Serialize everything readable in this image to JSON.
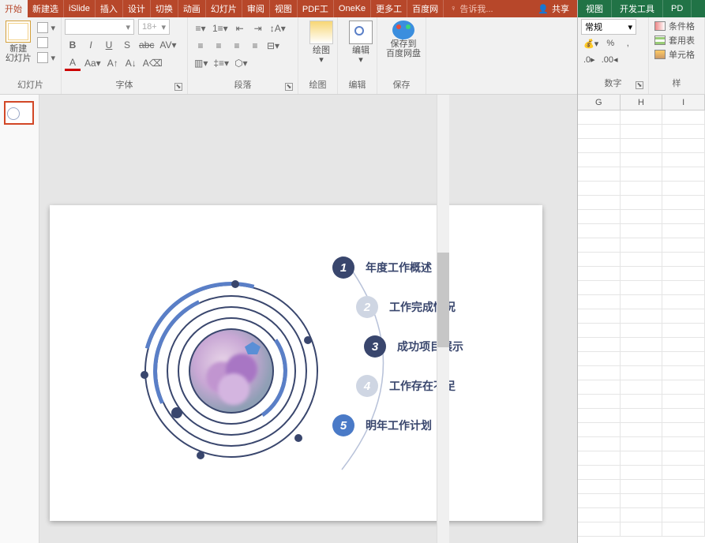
{
  "ppt": {
    "tabs": [
      "开始",
      "新建选",
      "iSlide",
      "插入",
      "设计",
      "切换",
      "动画",
      "幻灯片",
      "审阅",
      "视图",
      "PDF工",
      "OneKe",
      "更多工",
      "百度网"
    ],
    "tell_placeholder": "告诉我...",
    "share": "共享",
    "groups": {
      "slides": {
        "new_slide": "新建\n幻灯片",
        "label": "幻灯片"
      },
      "font": {
        "size_placeholder": "18+",
        "label": "字体"
      },
      "paragraph": {
        "label": "段落"
      },
      "draw": {
        "btn": "绘图",
        "label": "绘图"
      },
      "edit": {
        "btn": "编辑",
        "label": "编辑"
      },
      "save": {
        "btn": "保存到\n百度网盘",
        "label": "保存"
      }
    }
  },
  "slide": {
    "items": [
      {
        "num": "1",
        "label": "年度工作概述",
        "style": "dark"
      },
      {
        "num": "2",
        "label": "工作完成情况",
        "style": "light"
      },
      {
        "num": "3",
        "label": "成功项目展示",
        "style": "dark"
      },
      {
        "num": "4",
        "label": "工作存在不足",
        "style": "light"
      },
      {
        "num": "5",
        "label": "明年工作计划",
        "style": "mid"
      }
    ]
  },
  "excel": {
    "tabs": [
      "视图",
      "开发工具",
      "PD"
    ],
    "number_format": "常规",
    "percent": "%",
    "comma": ",",
    "number_label": "数字",
    "styles": {
      "cond": "条件格",
      "table": "套用表",
      "cell": "单元格",
      "label": "样"
    },
    "cols": [
      "G",
      "H",
      "I"
    ]
  }
}
